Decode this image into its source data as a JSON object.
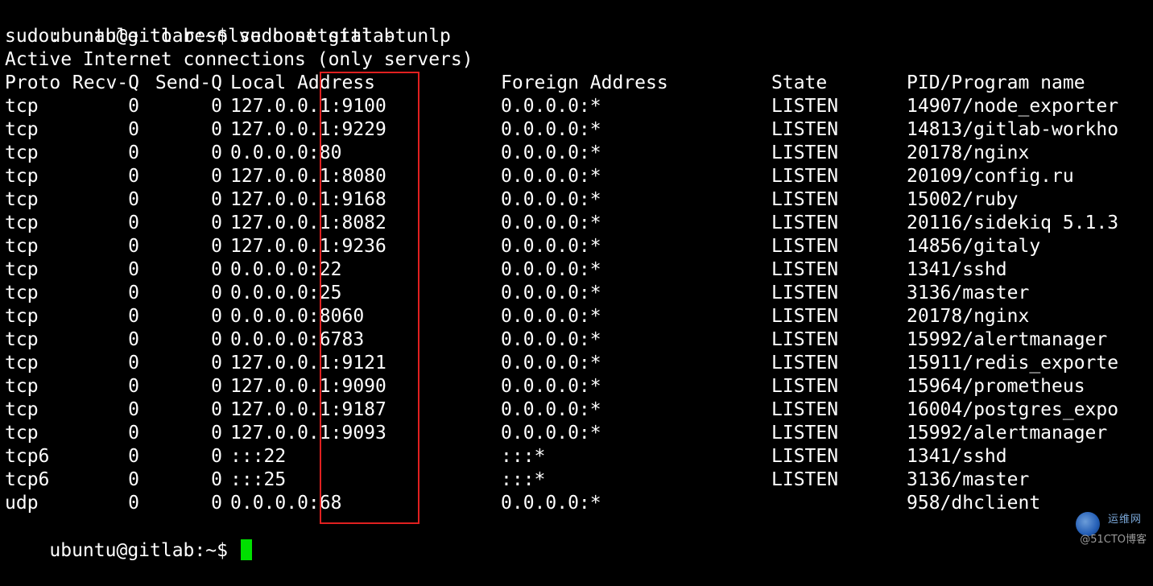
{
  "terminal": {
    "background": "#000000",
    "foreground": "#ffffff",
    "cursor_color": "#00e000",
    "highlight_color": "#e02020",
    "command_line": {
      "prompt": "ubuntu@gitlab:~$",
      "command": "sudo netstat -tunlp"
    },
    "error_line": "sudo: unable to resolve host gitlab",
    "info_line": "Active Internet connections (only servers)",
    "headers": {
      "proto": "Proto",
      "recv": "Recv-Q",
      "send": "Send-Q",
      "local": "Local Address",
      "foreign": "Foreign Address",
      "state": "State",
      "pid": "PID/Program name"
    },
    "rows": [
      {
        "proto": "tcp",
        "recv": "0",
        "send": "0",
        "local": "127.0.0.1:9100",
        "foreign": "0.0.0.0:*",
        "state": "LISTEN",
        "pid": "14907/node_exporter"
      },
      {
        "proto": "tcp",
        "recv": "0",
        "send": "0",
        "local": "127.0.0.1:9229",
        "foreign": "0.0.0.0:*",
        "state": "LISTEN",
        "pid": "14813/gitlab-workho"
      },
      {
        "proto": "tcp",
        "recv": "0",
        "send": "0",
        "local": "0.0.0.0:80",
        "foreign": "0.0.0.0:*",
        "state": "LISTEN",
        "pid": "20178/nginx"
      },
      {
        "proto": "tcp",
        "recv": "0",
        "send": "0",
        "local": "127.0.0.1:8080",
        "foreign": "0.0.0.0:*",
        "state": "LISTEN",
        "pid": "20109/config.ru"
      },
      {
        "proto": "tcp",
        "recv": "0",
        "send": "0",
        "local": "127.0.0.1:9168",
        "foreign": "0.0.0.0:*",
        "state": "LISTEN",
        "pid": "15002/ruby"
      },
      {
        "proto": "tcp",
        "recv": "0",
        "send": "0",
        "local": "127.0.0.1:8082",
        "foreign": "0.0.0.0:*",
        "state": "LISTEN",
        "pid": "20116/sidekiq 5.1.3"
      },
      {
        "proto": "tcp",
        "recv": "0",
        "send": "0",
        "local": "127.0.0.1:9236",
        "foreign": "0.0.0.0:*",
        "state": "LISTEN",
        "pid": "14856/gitaly"
      },
      {
        "proto": "tcp",
        "recv": "0",
        "send": "0",
        "local": "0.0.0.0:22",
        "foreign": "0.0.0.0:*",
        "state": "LISTEN",
        "pid": "1341/sshd"
      },
      {
        "proto": "tcp",
        "recv": "0",
        "send": "0",
        "local": "0.0.0.0:25",
        "foreign": "0.0.0.0:*",
        "state": "LISTEN",
        "pid": "3136/master"
      },
      {
        "proto": "tcp",
        "recv": "0",
        "send": "0",
        "local": "0.0.0.0:8060",
        "foreign": "0.0.0.0:*",
        "state": "LISTEN",
        "pid": "20178/nginx"
      },
      {
        "proto": "tcp",
        "recv": "0",
        "send": "0",
        "local": "0.0.0.0:6783",
        "foreign": "0.0.0.0:*",
        "state": "LISTEN",
        "pid": "15992/alertmanager"
      },
      {
        "proto": "tcp",
        "recv": "0",
        "send": "0",
        "local": "127.0.0.1:9121",
        "foreign": "0.0.0.0:*",
        "state": "LISTEN",
        "pid": "15911/redis_exporte"
      },
      {
        "proto": "tcp",
        "recv": "0",
        "send": "0",
        "local": "127.0.0.1:9090",
        "foreign": "0.0.0.0:*",
        "state": "LISTEN",
        "pid": "15964/prometheus"
      },
      {
        "proto": "tcp",
        "recv": "0",
        "send": "0",
        "local": "127.0.0.1:9187",
        "foreign": "0.0.0.0:*",
        "state": "LISTEN",
        "pid": "16004/postgres_expo"
      },
      {
        "proto": "tcp",
        "recv": "0",
        "send": "0",
        "local": "127.0.0.1:9093",
        "foreign": "0.0.0.0:*",
        "state": "LISTEN",
        "pid": "15992/alertmanager"
      },
      {
        "proto": "tcp6",
        "recv": "0",
        "send": "0",
        "local": ":::22",
        "foreign": ":::*",
        "state": "LISTEN",
        "pid": "1341/sshd"
      },
      {
        "proto": "tcp6",
        "recv": "0",
        "send": "0",
        "local": ":::25",
        "foreign": ":::*",
        "state": "LISTEN",
        "pid": "3136/master"
      },
      {
        "proto": "udp",
        "recv": "0",
        "send": "0",
        "local": "0.0.0.0:68",
        "foreign": "0.0.0.0:*",
        "state": "",
        "pid": "958/dhclient"
      }
    ],
    "final_prompt": "ubuntu@gitlab:~$"
  },
  "watermark": {
    "site": "运维网",
    "handle": "@51CTO博客"
  }
}
